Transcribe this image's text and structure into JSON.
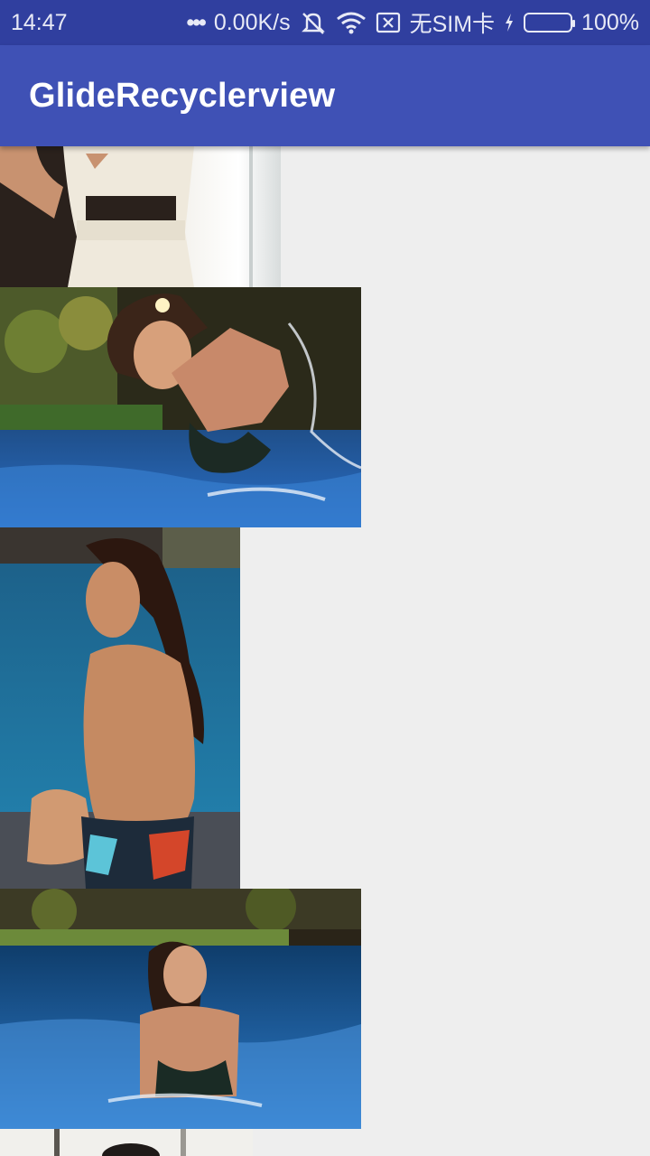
{
  "status_bar": {
    "time": "14:47",
    "dots": "•••",
    "net_speed": "0.00K/s",
    "sim_text": "无SIM卡",
    "battery_text": "100%",
    "icons": [
      "mute-icon",
      "wifi-icon",
      "no-sim-icon",
      "charging-icon",
      "battery-icon"
    ]
  },
  "app_bar": {
    "title": "GlideRecyclerview"
  },
  "photos": [
    {
      "name": "photo-1",
      "description": "white-outfit"
    },
    {
      "name": "photo-2",
      "description": "pool-splash"
    },
    {
      "name": "photo-3",
      "description": "pool-edge-swimsuit"
    },
    {
      "name": "photo-4",
      "description": "pool-water"
    },
    {
      "name": "photo-5",
      "description": "partial-next-item"
    }
  ],
  "colors": {
    "status_bar": "#303f9f",
    "app_bar": "#3f51b5",
    "background": "#eeeeee",
    "battery_fill": "#4ccd1c"
  }
}
